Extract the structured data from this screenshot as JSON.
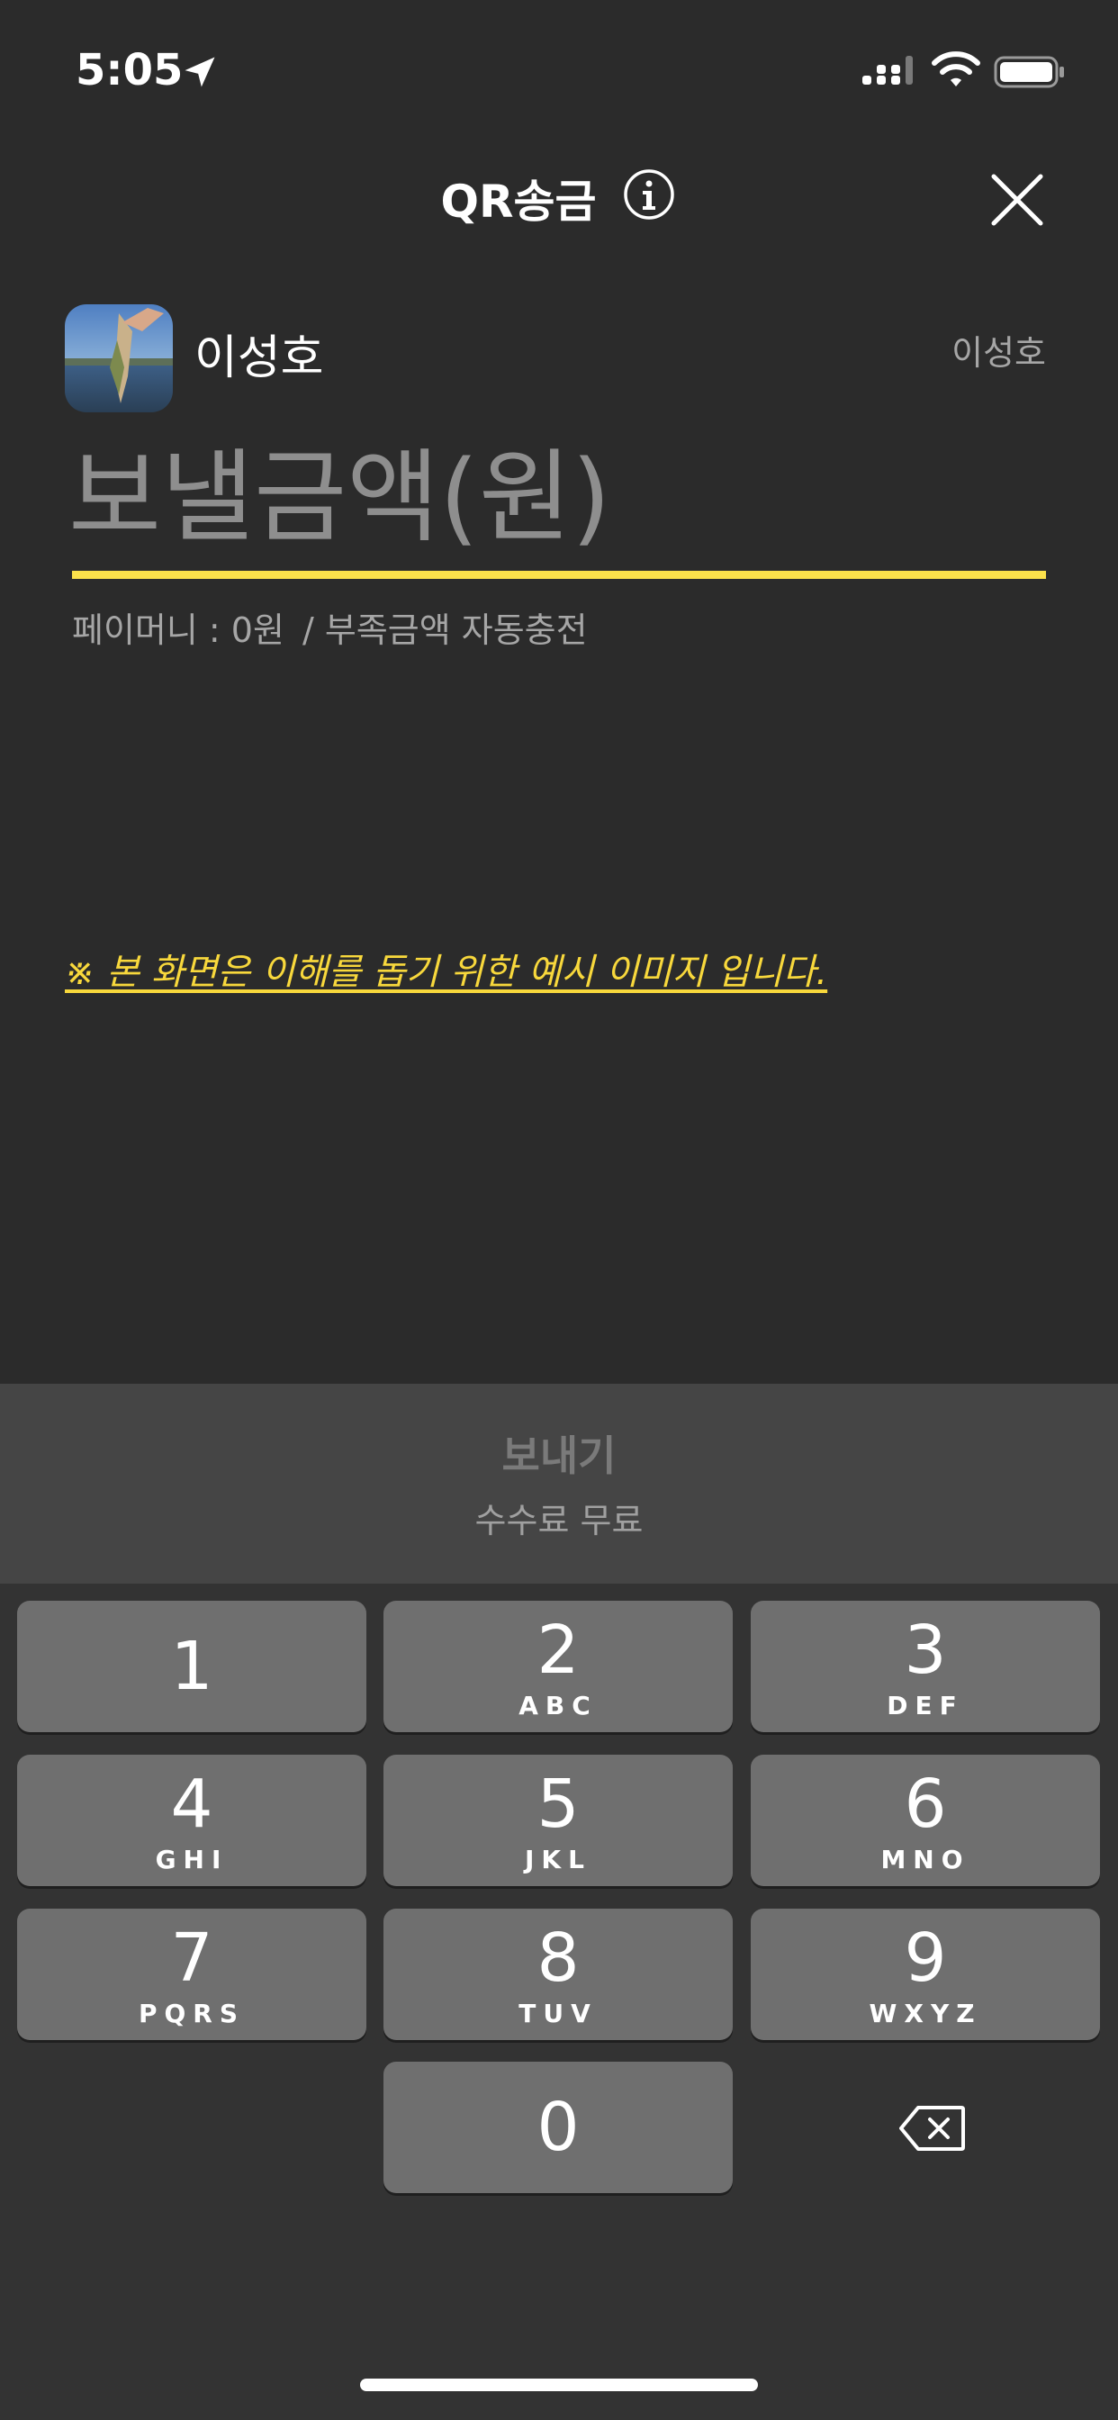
{
  "status_bar": {
    "time": "5:05",
    "icons": [
      "location-arrow-icon",
      "signal-icon",
      "wifi-icon",
      "battery-icon"
    ]
  },
  "header": {
    "title": "QR송금",
    "info_icon": "info-circle-icon",
    "close_icon": "close-x-icon"
  },
  "recipient": {
    "name": "이성호",
    "account_label": "이성호"
  },
  "amount": {
    "placeholder": "보낼금액(원)",
    "value": ""
  },
  "balance": {
    "text": "페이머니 : 0원",
    "auto_charge": "/ 부족금액 자동충전"
  },
  "notice": {
    "text": "※ 본 화면은 이해를 돕기 위한 예시 이미지 입니다."
  },
  "send": {
    "label": "보내기",
    "fee": "수수료 무료"
  },
  "keypad": {
    "keys": [
      {
        "digit": "1",
        "letters": ""
      },
      {
        "digit": "2",
        "letters": "ABC"
      },
      {
        "digit": "3",
        "letters": "DEF"
      },
      {
        "digit": "4",
        "letters": "GHI"
      },
      {
        "digit": "5",
        "letters": "JKL"
      },
      {
        "digit": "6",
        "letters": "MNO"
      },
      {
        "digit": "7",
        "letters": "PQRS"
      },
      {
        "digit": "8",
        "letters": "TUV"
      },
      {
        "digit": "9",
        "letters": "WXYZ"
      },
      {
        "digit": "0",
        "letters": ""
      }
    ],
    "backspace_icon": "backspace-icon"
  },
  "colors": {
    "background": "#2b2b2b",
    "accent_yellow": "#fbe14b",
    "notice_yellow": "#f8d83c",
    "key": "#6f6f6f",
    "send_area": "#454545"
  }
}
